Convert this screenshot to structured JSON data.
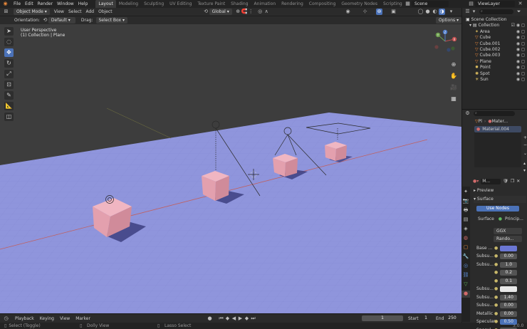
{
  "top_menu": [
    "File",
    "Edit",
    "Render",
    "Window",
    "Help"
  ],
  "workspace_tabs": [
    {
      "label": "Layout",
      "active": true
    },
    {
      "label": "Modeling",
      "active": false
    },
    {
      "label": "Sculpting",
      "active": false
    },
    {
      "label": "UV Editing",
      "active": false
    },
    {
      "label": "Texture Paint",
      "active": false
    },
    {
      "label": "Shading",
      "active": false
    },
    {
      "label": "Animation",
      "active": false
    },
    {
      "label": "Rendering",
      "active": false
    },
    {
      "label": "Compositing",
      "active": false
    },
    {
      "label": "Geometry Nodes",
      "active": false
    },
    {
      "label": "Scripting",
      "active": false
    }
  ],
  "scene_field": "Scene",
  "view_layer_field": "ViewLayer",
  "header": {
    "mode": "Object Mode",
    "menus": [
      "View",
      "Select",
      "Add",
      "Object"
    ],
    "transform_orientation": "Global"
  },
  "tool_options": {
    "orientation_label": "Orientation:",
    "orientation_value": "Default",
    "drag_label": "Drag:",
    "drag_value": "Select Box",
    "options_label": "Options"
  },
  "viewport": {
    "line1": "User Perspective",
    "line2": "(1) Collection | Plane",
    "gizmo": {
      "x": "X",
      "y": "Y",
      "z": "Z"
    }
  },
  "outliner": {
    "root": "Scene Collection",
    "collection": "Collection",
    "items": [
      {
        "name": "Area",
        "icon": "area-light-icon"
      },
      {
        "name": "Cube",
        "icon": "mesh-icon"
      },
      {
        "name": "Cube.001",
        "icon": "mesh-icon"
      },
      {
        "name": "Cube.002",
        "icon": "mesh-icon"
      },
      {
        "name": "Cube.003",
        "icon": "mesh-icon"
      },
      {
        "name": "Plane",
        "icon": "mesh-icon"
      },
      {
        "name": "Point",
        "icon": "point-light-icon"
      },
      {
        "name": "Spot",
        "icon": "spot-light-icon"
      },
      {
        "name": "Sun",
        "icon": "sun-light-icon"
      }
    ]
  },
  "properties": {
    "breadcrumb_object": "Pl",
    "breadcrumb_material": "Mater...",
    "material_slot": "Material.004",
    "material_name": "M...",
    "preview_label": "Preview",
    "surface_panel": "Surface",
    "use_nodes_label": "Use Nodes",
    "surface_label": "Surface",
    "surface_value": "Princip...",
    "distribution": "GGX",
    "subsurface_method": "Rando...",
    "rows": [
      {
        "label": "Base ...",
        "value": "",
        "type": "color",
        "color": "#6b77d4"
      },
      {
        "label": "Subsu...",
        "value": "0.00",
        "type": "num"
      },
      {
        "label": "Subsu...",
        "value": "1.0",
        "type": "num"
      },
      {
        "label": "",
        "value": "0.2",
        "type": "num"
      },
      {
        "label": "",
        "value": "0.1",
        "type": "num"
      },
      {
        "label": "Subsu...",
        "value": "",
        "type": "color",
        "color": "#e8e8e8"
      },
      {
        "label": "Subsu...",
        "value": "1.40",
        "type": "num"
      },
      {
        "label": "Subsu...",
        "value": "0.00",
        "type": "num"
      },
      {
        "label": "Metallic",
        "value": "0.00",
        "type": "num"
      },
      {
        "label": "Specular",
        "value": "0.50",
        "type": "num-accent"
      },
      {
        "label": "Specul...",
        "value": "",
        "type": "num"
      }
    ]
  },
  "timeline": {
    "menus": [
      "Playback",
      "Keying",
      "View",
      "Marker"
    ],
    "current_frame": "1",
    "start_label": "Start",
    "start_value": "1",
    "end_label": "End",
    "end_value": "250"
  },
  "statusbar": {
    "left": "Select (Toggle)",
    "middle": "Dolly View",
    "right": "Lasso Select",
    "version": "3.0.0"
  },
  "colors": {
    "active_tab": "#4b72b8",
    "floor": "#8f95dc",
    "cube": "#e0a1ae"
  }
}
